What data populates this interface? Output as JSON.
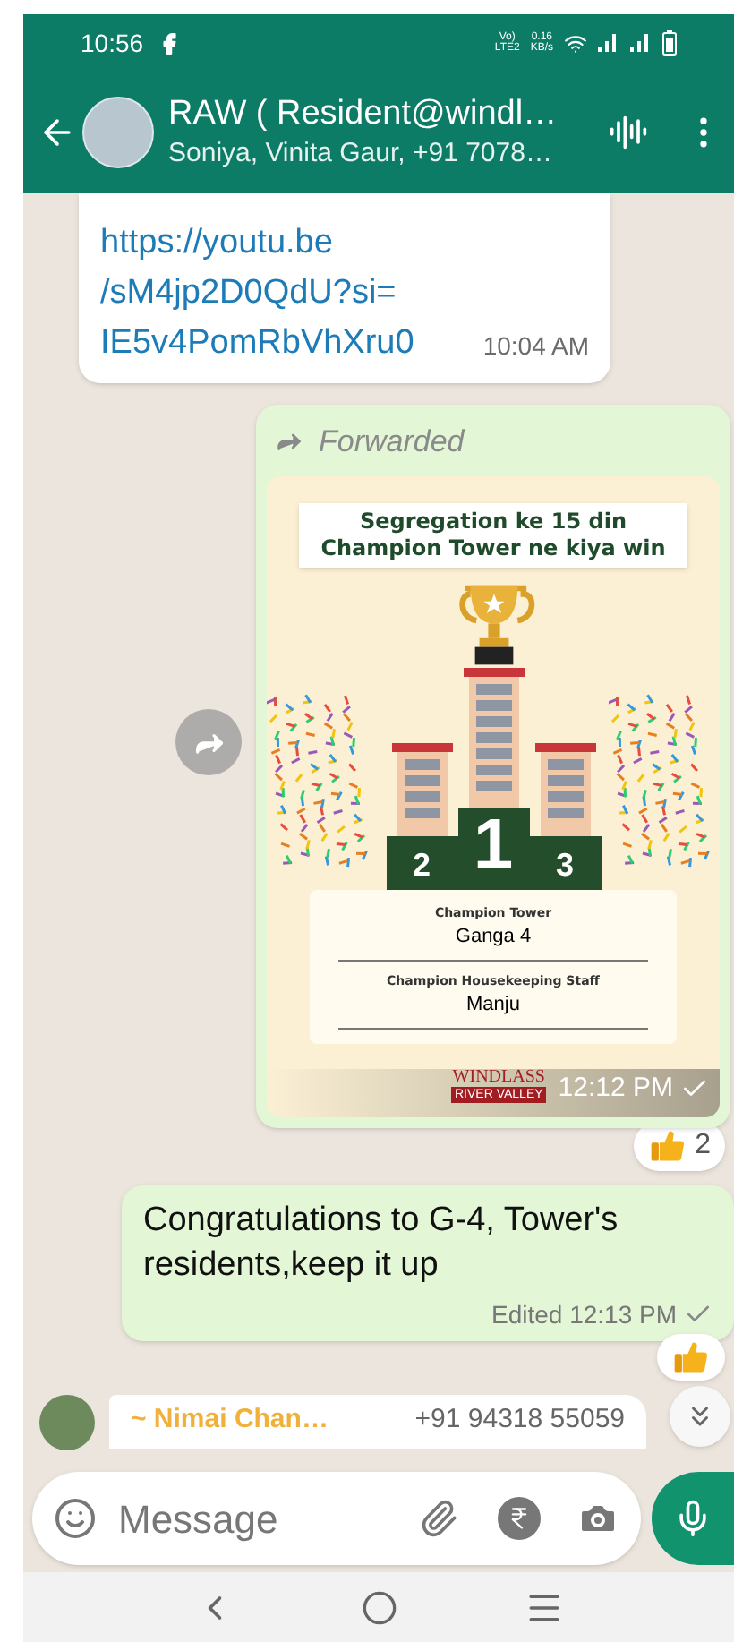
{
  "status_bar": {
    "time": "10:56",
    "volte_top": "Vo)",
    "volte_bottom": "LTE2",
    "speed_value": "0.16",
    "speed_unit": "KB/s"
  },
  "header": {
    "title": "RAW ( Resident@windl…",
    "subtitle": "Soniya, Vinita Gaur, +91 7078…"
  },
  "messages": [
    {
      "kind": "link",
      "lines": [
        "https://youtu.be",
        "/sM4jp2D0QdU?si=",
        "IE5v4PomRbVhXru0"
      ],
      "time": "10:04 AM"
    },
    {
      "kind": "image",
      "forwarded_label": "Forwarded",
      "time": "12:12 PM",
      "image": {
        "heading": [
          "Segregation ke 15 din",
          "Champion Tower ne kiya win"
        ],
        "places": [
          "2",
          "1",
          "3"
        ],
        "fields": [
          {
            "label": "Champion Tower",
            "value": "Ganga 4"
          },
          {
            "label": "Champion Housekeeping Staff",
            "value": "Manju"
          }
        ],
        "logo_name": "WINDLASS",
        "logo_sub": "RIVER VALLEY"
      },
      "reaction_count": "2"
    },
    {
      "kind": "text",
      "text": "Congratulations to G-4, Tower's residents,keep it up",
      "time": "Edited 12:13 PM"
    },
    {
      "kind": "incoming",
      "sender": "~ Nimai Chan…",
      "phone": "+91 94318 55059"
    }
  ],
  "composer": {
    "placeholder": "Message"
  }
}
